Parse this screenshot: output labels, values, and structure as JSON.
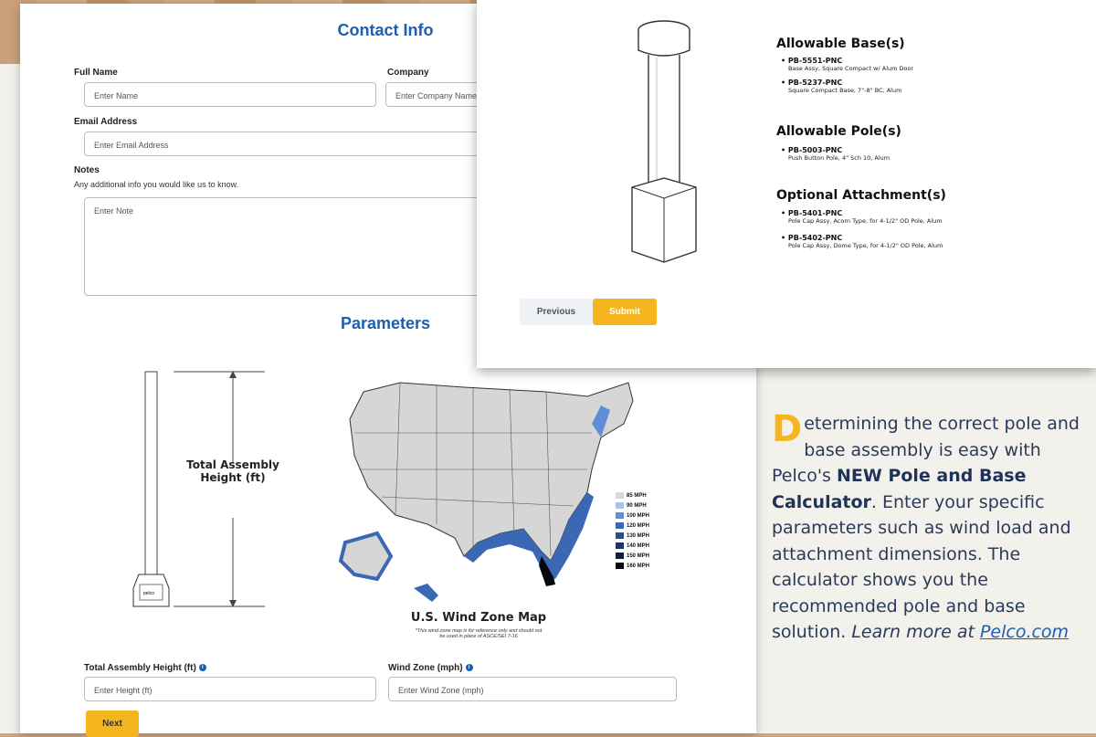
{
  "contact": {
    "title": "Contact Info",
    "full_name_label": "Full Name",
    "full_name_placeholder": "Enter Name",
    "company_label": "Company",
    "company_placeholder": "Enter Company Name",
    "email_label": "Email Address",
    "email_placeholder": "Enter Email Address",
    "notes_label": "Notes",
    "notes_help": "Any additional info you would like us to know.",
    "notes_placeholder": "Enter Note"
  },
  "parameters": {
    "title": "Parameters",
    "assembly_label": "Total Assembly Height (ft)",
    "height_label": "Total Assembly Height (ft)",
    "height_placeholder": "Enter Height (ft)",
    "wind_label": "Wind Zone (mph)",
    "wind_placeholder": "Enter Wind Zone (mph)",
    "pole_badge": "pelco",
    "next_label": "Next"
  },
  "map": {
    "title": "U.S. Wind Zone Map",
    "note": "*This wind zone map is for reference only and should not be used in place of ASCE/SEI 7-16",
    "legend": [
      {
        "label": "85 MPH",
        "color": "#d9d9d9"
      },
      {
        "label": "90 MPH",
        "color": "#a9c4e8"
      },
      {
        "label": "100 MPH",
        "color": "#5e8fd6"
      },
      {
        "label": "120 MPH",
        "color": "#3a68b5"
      },
      {
        "label": "130 MPH",
        "color": "#2b4d8a"
      },
      {
        "label": "140 MPH",
        "color": "#1d3560"
      },
      {
        "label": "150 MPH",
        "color": "#121f3a"
      },
      {
        "label": "160 MPH",
        "color": "#05070d"
      }
    ]
  },
  "results": {
    "bases_title": "Allowable Base(s)",
    "bases": [
      {
        "code": "PB-5551-PNC",
        "desc": "Base Assy, Square Compact w/ Alum Door"
      },
      {
        "code": "PB-5237-PNC",
        "desc": "Square Compact Base, 7\"-8\" BC, Alum"
      }
    ],
    "poles_title": "Allowable Pole(s)",
    "poles": [
      {
        "code": "PB-5003-PNC",
        "desc": "Push Button Pole, 4\" Sch 10, Alum"
      }
    ],
    "attach_title": "Optional Attachment(s)",
    "attachments": [
      {
        "code": "PB-5401-PNC",
        "desc": "Pole Cap Assy, Acorn Type, for 4-1/2\" OD Pole, Alum"
      },
      {
        "code": "PB-5402-PNC",
        "desc": "Pole Cap Assy, Dome Type, for 4-1/2\" OD Pole, Alum"
      }
    ],
    "previous_label": "Previous",
    "submit_label": "Submit"
  },
  "article": {
    "dropcap": "D",
    "p1": "etermining the correct pole and base assembly is easy with Pelco's ",
    "bold": "NEW Pole and Base Calculator",
    "p2": ". Enter your specific parameters such as wind load and attachment dimensions. The calculator shows you the recommended pole and base solution. ",
    "learn": "Learn more at ",
    "link": "Pelco.com"
  },
  "colors": {
    "accent": "#f5b51f",
    "brand_blue": "#1c5fb0"
  }
}
